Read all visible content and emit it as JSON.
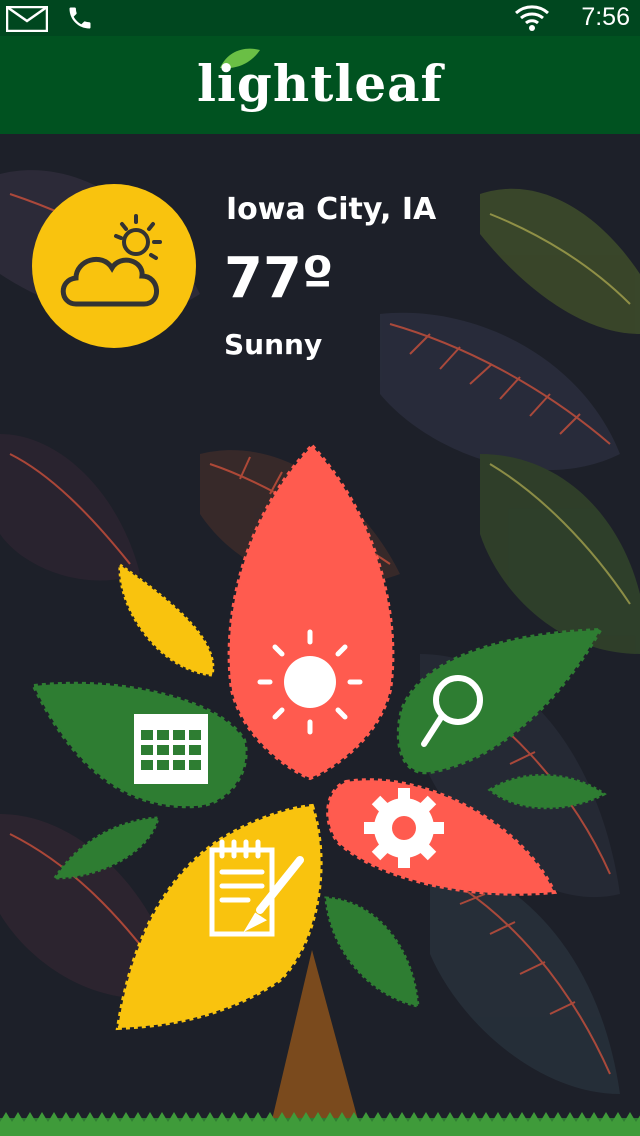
{
  "status_bar": {
    "time": "7:56",
    "icons": [
      "mail-icon",
      "phone-icon",
      "wifi-icon"
    ]
  },
  "app": {
    "logo": "lightleaf"
  },
  "weather": {
    "icon": "partly-cloudy-icon",
    "city": "Iowa City, IA",
    "temperature": "77º",
    "condition": "Sunny"
  },
  "tree_menu": [
    {
      "id": "sunlight",
      "icon": "sun-icon",
      "color": "#ff5b4f"
    },
    {
      "id": "search",
      "icon": "search-icon",
      "color": "#2e7d32"
    },
    {
      "id": "calendar",
      "icon": "calendar-icon",
      "color": "#2e7d32"
    },
    {
      "id": "settings",
      "icon": "gear-icon",
      "color": "#ff5b4f"
    },
    {
      "id": "notes",
      "icon": "notepad-icon",
      "color": "#f9c30e"
    }
  ],
  "colors": {
    "status_bar": "#00471f",
    "app_bar": "#005220",
    "accent_yellow": "#f9c30e",
    "accent_red": "#ff5b4f",
    "accent_green": "#2e7d32",
    "trunk": "#7a4a1d"
  }
}
